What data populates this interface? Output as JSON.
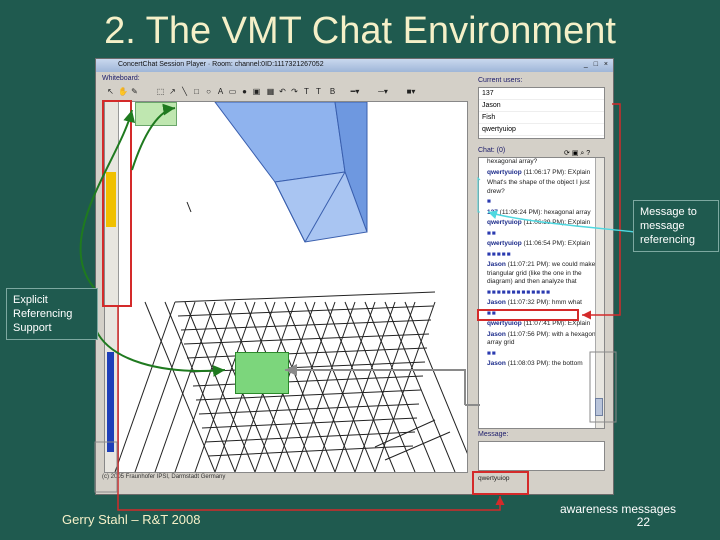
{
  "slide": {
    "title": "2. The VMT Chat Environment",
    "footer_author": "Gerry Stahl – R&T 2008",
    "page_number": "22"
  },
  "window": {
    "title": "ConcertChat Session Player · Room: channel:0ID:1117321267052",
    "controls": "_ □ ×"
  },
  "whiteboard": {
    "label": "Whiteboard:",
    "status_text": "(c) 2005 Fraunhofer IPSI, Darmstadt Germany"
  },
  "toolbar_tools": [
    "arrow",
    "hand",
    "pencil",
    "line",
    "rect",
    "ellipse",
    "text",
    "image",
    "grid",
    "undo",
    "redo",
    "color",
    "width"
  ],
  "users": {
    "label": "Current users:",
    "list": [
      "137",
      "Jason",
      "Fish",
      "qwertyuiop"
    ]
  },
  "chat": {
    "label": "Chat: (0)",
    "messages": [
      {
        "who": "",
        "text": "hexagonal array?"
      },
      {
        "who": "qwertyuiop",
        "text": "(11:06:17 PM): EXplain"
      },
      {
        "who": "",
        "text": "What's the shape of the object I just drew?"
      },
      {
        "who": "",
        "aw": "■"
      },
      {
        "who": "137",
        "text": "(11:06:24 PM): hexagonal array"
      },
      {
        "who": "qwertyuiop",
        "text": "(11:06:39 PM): EXplain"
      },
      {
        "who": "",
        "aw": "■■"
      },
      {
        "who": "qwertyuiop",
        "text": "(11:06:54 PM): EXplain"
      },
      {
        "who": "",
        "aw": "■■■■■"
      },
      {
        "who": "Jason",
        "text": "(11:07:21 PM): we could make a triangular grid (like the one in the diagram) and then analyze that"
      },
      {
        "who": "",
        "aw": "■■■■■■■■■■■■■"
      },
      {
        "who": "Jason",
        "text": "(11:07:32 PM): hmm what"
      },
      {
        "who": "",
        "aw": "■■"
      },
      {
        "who": "qwertyuiop",
        "text": "(11:07:41 PM): EXplain"
      },
      {
        "who": "Jason",
        "text": "(11:07:56 PM): with a hexagonal array grid"
      },
      {
        "who": "",
        "aw": "■■"
      },
      {
        "who": "Jason",
        "text": "(11:08:03 PM): the bottom"
      }
    ]
  },
  "message_input": {
    "label": "Message:",
    "status": "qwertyuiop"
  },
  "callouts": {
    "msg_ref": "Message to message referencing",
    "explicit": "Explicit Referencing Support",
    "awareness": "awareness messages"
  },
  "colors": {
    "background": "#1f5a4f",
    "title": "#f5f0c8",
    "red_box": "#d42a2a",
    "green_arrow": "#1f7a1f",
    "cyan_arrow": "#4fd8e0",
    "gray_arrow": "#8a8a8a"
  }
}
